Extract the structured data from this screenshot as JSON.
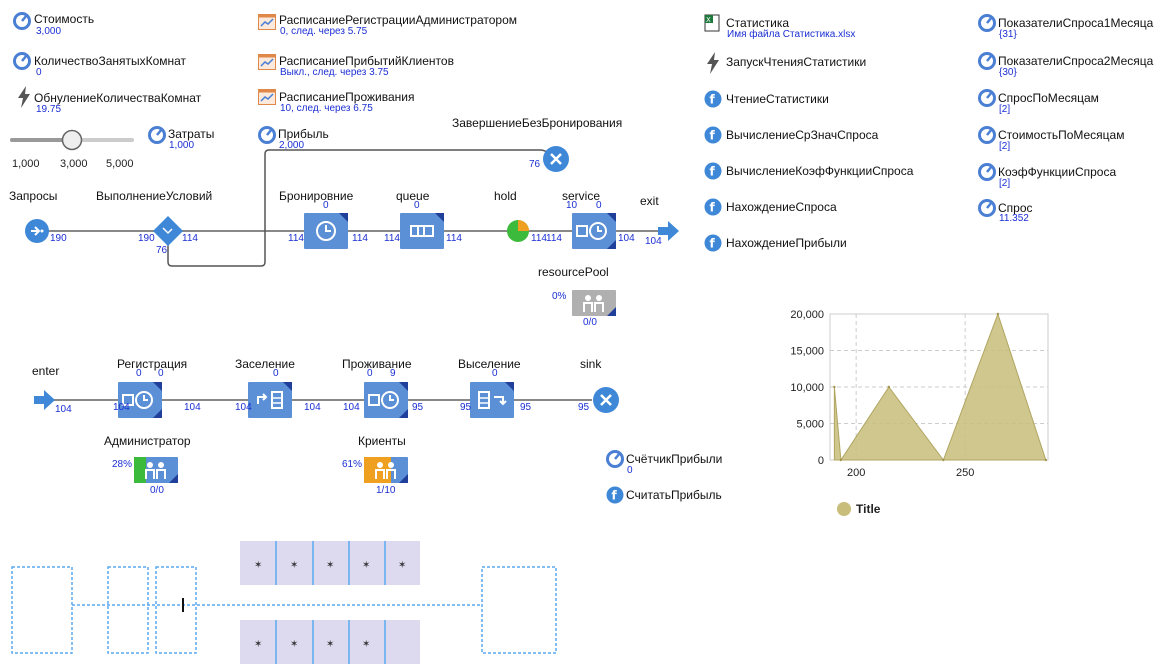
{
  "colors": {
    "accent": "#1b2fd3",
    "block": "#5b8fd6",
    "area": "#c8bd7a",
    "connector": "#888888"
  },
  "params": [
    {
      "label": "Стоимость",
      "value": "3,000"
    },
    {
      "label": "КоличествоЗанятыхКомнат",
      "value": "0"
    },
    {
      "label": "ОбнулениеКоличестваКомнат",
      "value": "19.75"
    },
    {
      "label": "Затраты",
      "value": "1,000"
    },
    {
      "label": "Прибыль",
      "value": "2,000"
    }
  ],
  "slider": {
    "min": "1,000",
    "mid": "3,000",
    "max": "5,000"
  },
  "schedules": [
    {
      "label": "РасписаниеРегистрацииАдминистратором",
      "value": "0, след. через 5.75"
    },
    {
      "label": "РасписаниеПрибытийКлиентов",
      "value": "Выкл., след. через 3.75"
    },
    {
      "label": "РасписаниеПроживания",
      "value": "10, след. через 6.75"
    }
  ],
  "stats": {
    "label": "Статистика",
    "value": "Имя файла Статистика.xlsx"
  },
  "event": {
    "label": "ЗапускЧтенияСтатистики"
  },
  "functions": [
    "ЧтениеСтатистики",
    "ВычислениеСрЗначСпроса",
    "ВычислениеКоэфФункцииСпроса",
    "НахождениеСпроса",
    "НахождениеПрибыли"
  ],
  "vars": [
    {
      "label": "ПоказателиСпроса1Месяца",
      "value": "{31}"
    },
    {
      "label": "ПоказателиСпроса2Месяца",
      "value": "{30}"
    },
    {
      "label": "СпросПоМесяцам",
      "value": "[2]"
    },
    {
      "label": "СтоимостьПоМесяцам",
      "value": "[2]"
    },
    {
      "label": "КоэфФункцииСпроса",
      "value": "[2]"
    },
    {
      "label": "Спрос",
      "value": "11.352"
    }
  ],
  "flow1": {
    "zaprosy": "Запросы",
    "zaprosy_out": "190",
    "vypoln": "ВыполнениеУсловий",
    "vypoln_in": "190",
    "vypoln_out": "114",
    "vypoln_down": "76",
    "zavershenie": "ЗавершениеБезБронирования",
    "zavershenie_in": "76",
    "bron": "Бронировние",
    "bron_n": "0",
    "bron_in": "114",
    "bron_out": "114",
    "queue": "queue",
    "queue_n": "0",
    "queue_in": "114",
    "queue_out": "114",
    "hold": "hold",
    "hold_out": "114",
    "service": "service",
    "service_n1": "10",
    "service_n2": "0",
    "service_in": "114",
    "service_out": "104",
    "exit": "exit",
    "exit_n": "104",
    "resourcePool": "resourcePool",
    "rp_pct": "0%",
    "rp_count": "0/0"
  },
  "flow2": {
    "enter": "enter",
    "enter_n": "104",
    "reg": "Регистрация",
    "reg_n1": "0",
    "reg_n2": "0",
    "reg_in": "104",
    "reg_out": "104",
    "zas": "Заселение",
    "zas_n": "0",
    "zas_in": "104",
    "zas_out": "104",
    "prozh": "Проживание",
    "prozh_n1": "0",
    "prozh_n2": "9",
    "prozh_in": "104",
    "prozh_out": "95",
    "vys": "Выселение",
    "vys_n": "0",
    "vys_in": "95",
    "vys_out": "95",
    "sink": "sink",
    "sink_n": "95",
    "admin": "Администратор",
    "admin_pct": "28%",
    "admin_count": "0/0",
    "clients": "Криенты",
    "clients_pct": "61%",
    "clients_count": "1/10"
  },
  "counter": {
    "label": "СчётчикПрибыли",
    "value": "0"
  },
  "counterFn": "СчитатьПрибыль",
  "chart_data": {
    "type": "area",
    "x": [
      190,
      193,
      215,
      240,
      265,
      287
    ],
    "y": [
      10000,
      0,
      10000,
      0,
      20000,
      0
    ],
    "xlim": [
      188,
      288
    ],
    "ylim": [
      0,
      20000
    ],
    "yticks": [
      "0",
      "5,000",
      "10,000",
      "15,000",
      "20,000"
    ],
    "ytick_values": [
      0,
      5000,
      10000,
      15000,
      20000
    ],
    "xticks": [
      "200",
      "250"
    ],
    "xtick_values": [
      200,
      250
    ],
    "legend": "Title",
    "grid": true,
    "color": "#c8bd7a"
  }
}
